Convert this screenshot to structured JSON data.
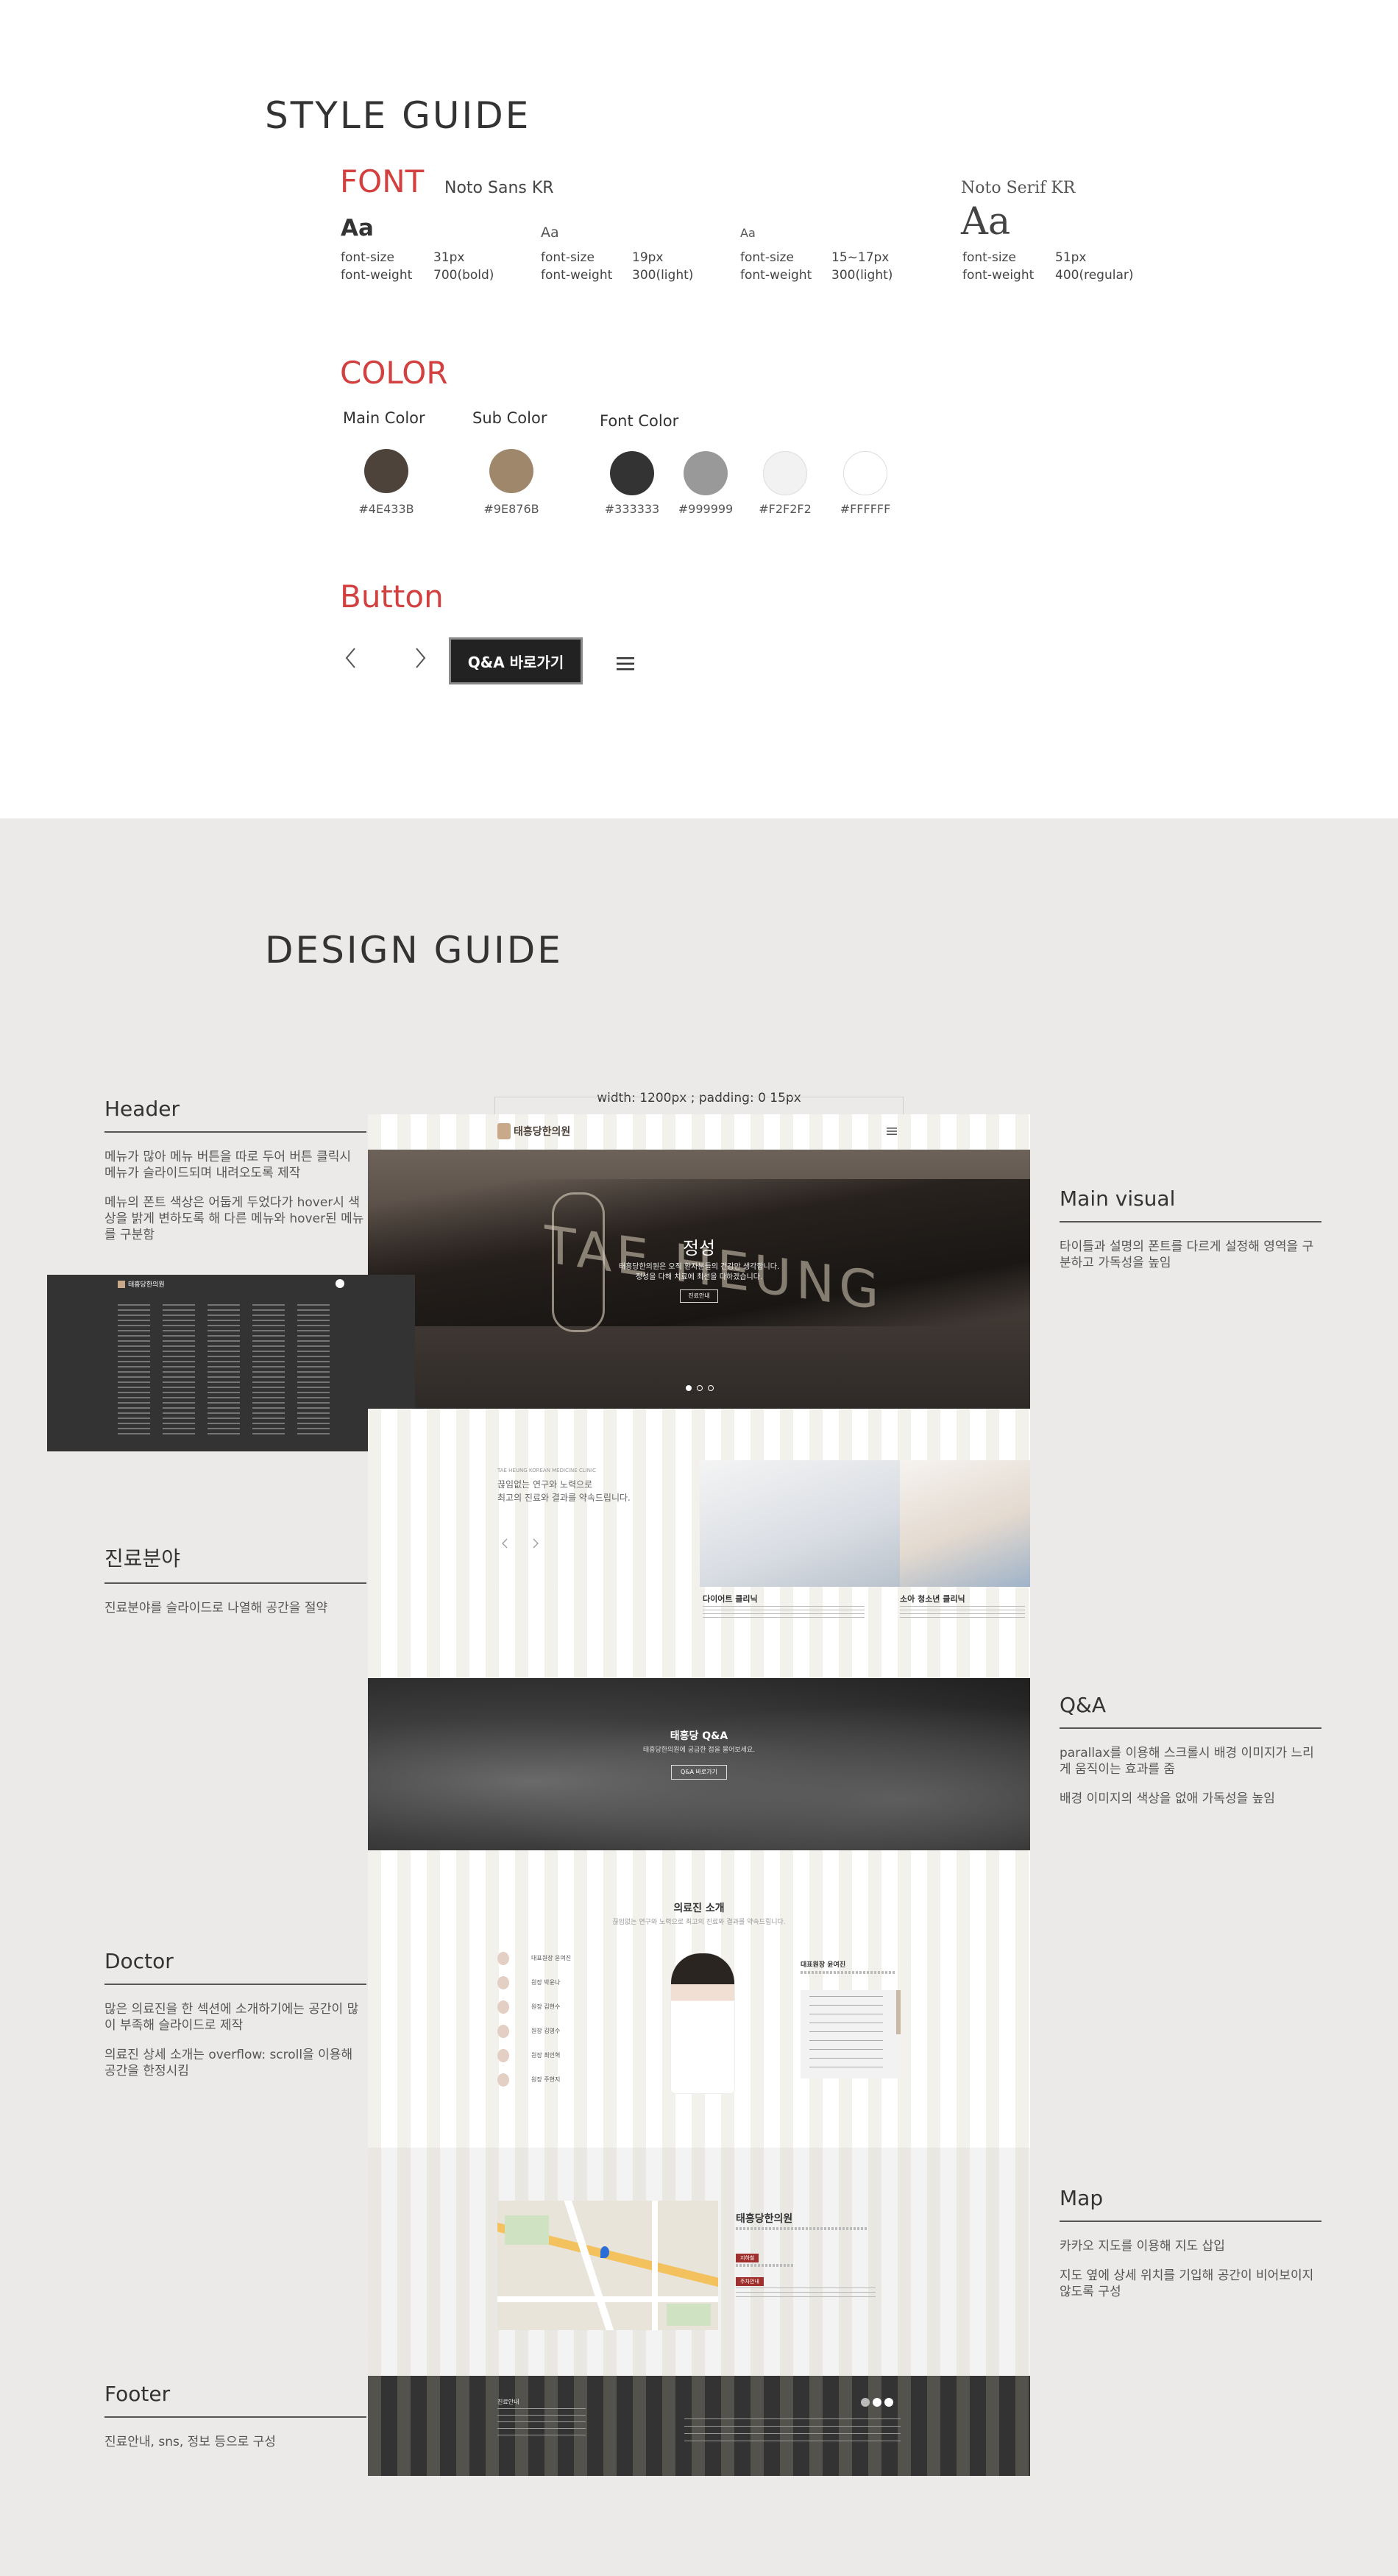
{
  "style_guide": {
    "title": "STYLE GUIDE",
    "font": {
      "label": "FONT",
      "sans_name": "Noto Sans KR",
      "serif_name": "Noto Serif KR",
      "specimens": [
        {
          "sample": "Aa",
          "size_label": "font-size",
          "size": "31px",
          "weight_label": "font-weight",
          "weight": "700(bold)"
        },
        {
          "sample": "Aa",
          "size_label": "font-size",
          "size": "19px",
          "weight_label": "font-weight",
          "weight": "300(light)"
        },
        {
          "sample": "Aa",
          "size_label": "font-size",
          "size": "15~17px",
          "weight_label": "font-weight",
          "weight": "300(light)"
        },
        {
          "sample": "Aa",
          "size_label": "font-size",
          "size": "51px",
          "weight_label": "font-weight",
          "weight": "400(regular)"
        }
      ]
    },
    "color": {
      "label": "COLOR",
      "main_label": "Main Color",
      "sub_label": "Sub Color",
      "font_label": "Font Color",
      "swatches": [
        {
          "hex": "#4E433B"
        },
        {
          "hex": "#9E876B"
        },
        {
          "hex": "#333333"
        },
        {
          "hex": "#999999"
        },
        {
          "hex": "#F2F2F2"
        },
        {
          "hex": "#FFFFFF"
        }
      ]
    },
    "button": {
      "label": "Button",
      "qa_label": "Q&A 바로가기"
    }
  },
  "design_guide": {
    "title": "DESIGN GUIDE",
    "width_note": "width: 1200px ; padding: 0 15px",
    "notes": {
      "header": {
        "title": "Header",
        "p1": "메뉴가 많아 메뉴 버튼을 따로 두어 버튼 클릭시 메뉴가 슬라이드되며 내려오도록 제작",
        "p2": "메뉴의 폰트 색상은 어둡게 두었다가 hover시 색상을 밝게 변하도록 해 다른 메뉴와 hover된 메뉴를 구분함"
      },
      "main_visual": {
        "title": "Main visual",
        "p1": "타이틀과 설명의 폰트를 다르게 설정해 영역을 구분하고 가독성을 높임"
      },
      "clinic": {
        "title": "진료분야",
        "p1": "진료분야를 슬라이드로 나열해 공간을 절약"
      },
      "qa": {
        "title": "Q&A",
        "p1": "parallax를 이용해 스크롤시 배경 이미지가 느리게 움직이는 효과를 줌",
        "p2": "배경 이미지의 색상을 없애 가독성을 높임"
      },
      "doctor": {
        "title": "Doctor",
        "p1": "많은 의료진을 한 섹션에 소개하기에는 공간이 많이 부족해 슬라이드로 제작",
        "p2": "의료진 상세 소개는 overflow: scroll을 이용해 공간을 한정시킴"
      },
      "map": {
        "title": "Map",
        "p1": "카카오 지도를 이용해 지도 삽입",
        "p2": "지도 옆에 상세 위치를 기입해 공간이 비어보이지 않도록 구성"
      },
      "footer": {
        "title": "Footer",
        "p1": "진료안내, sns, 정보 등으로 구성"
      }
    },
    "mock": {
      "logo_text": "태흥당한의원",
      "visual_title": "정성",
      "visual_sub1": "태흥당한의원은 오직 환자분들의 건강만 생각합니다.",
      "visual_sub2": "정성을 다해 치료에 최선을 다하겠습니다.",
      "visual_btn": "진료안내",
      "clinic_eng": "TAE HEUNG KOREAN MEDICINE CLINIC",
      "clinic_line1": "끊임없는 연구와 노력으로",
      "clinic_line2": "최고의 진료와 결과를 약속드립니다.",
      "card1_title": "다이어트 클리닉",
      "card2_title": "소아 청소년 클리닉",
      "qa_title": "태흥당 Q&A",
      "qa_sub": "태흥당한의원에 궁금한 점을 물어보세요.",
      "qa_btn": "Q&A 바로가기",
      "doctor_title": "의료진 소개",
      "doctor_sub": "끊임없는 연구와 노력으로 최고의 진료와 결과를 약속드립니다.",
      "doctor_list": [
        "대표원장 윤여진",
        "원장 박윤나",
        "원장 김현수",
        "원장 김영수",
        "원장 최인혁",
        "원장 주현지"
      ],
      "doctor_card_title": "대표원장 윤여진",
      "map_name": "태흥당한의원",
      "map_badge1": "지하철",
      "map_badge2": "주차안내",
      "footer_title": "진료안내"
    }
  }
}
